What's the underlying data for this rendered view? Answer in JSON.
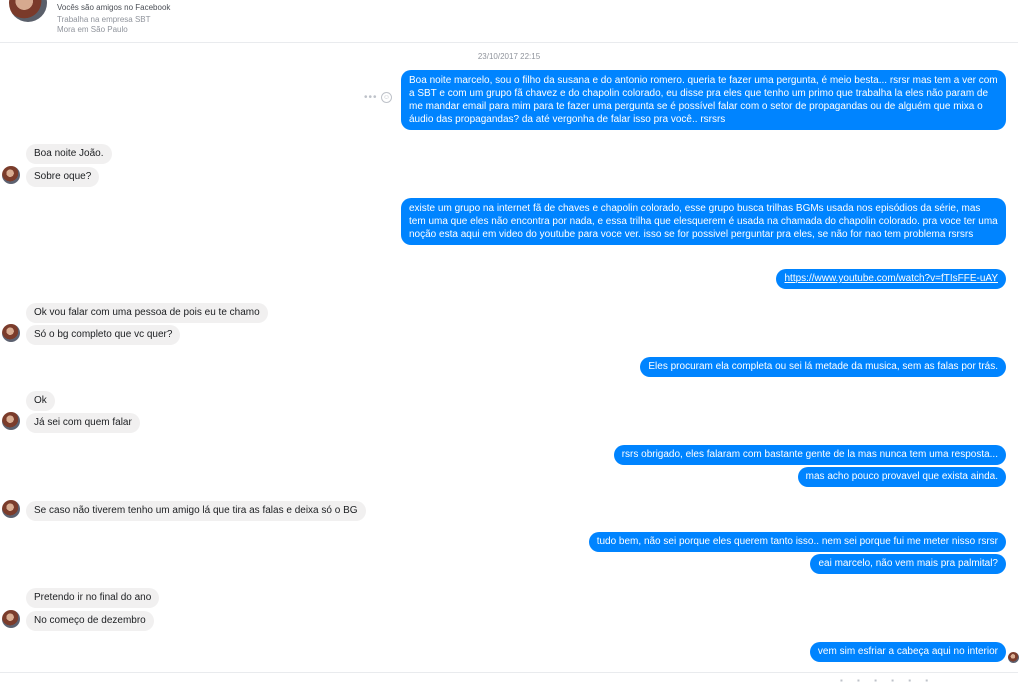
{
  "profile": {
    "friends_text": "Vocês são amigos no Facebook",
    "work_text": "Trabalha na empresa SBT",
    "city_text": "Mora em São Paulo"
  },
  "timestamp": "23/10/2017 22:15",
  "messages": [
    {
      "from": "me",
      "text": "Boa noite marcelo, sou o filho da susana e do antonio romero. queria te fazer uma pergunta, é meio besta... rsrsr mas tem a ver com a SBT e com um grupo fã chavez e do chapolin colorado, eu disse pra eles que tenho um primo que trabalha la eles não param de me mandar email para mim para te fazer uma pergunta se é possível falar com o setor de propagandas ou de alguém que mixa o áudio das propagandas? da até vergonha de falar isso pra você.. rsrsrs"
    },
    {
      "from": "them",
      "text": "Boa noite João."
    },
    {
      "from": "them",
      "text": "Sobre oque?"
    },
    {
      "from": "me",
      "text": "existe um grupo na internet fã de chaves e chapolin colorado, esse grupo busca trilhas BGMs usada nos episódios da série, mas tem uma que eles não encontra por nada, e essa  trilha que elesquerem é usada na chamada do chapolin colorado. pra voce ter uma noção esta aqui em video do youtube para voce ver. isso se for possivel perguntar pra eles, se não for nao tem problema rsrsrs"
    },
    {
      "from": "me",
      "text": "https://www.youtube.com/watch?v=fTIsFFE-uAY"
    },
    {
      "from": "them",
      "text": "Ok vou falar com uma pessoa de pois eu te chamo"
    },
    {
      "from": "them",
      "text": "Só o bg  completo que vc quer?"
    },
    {
      "from": "me",
      "text": "Eles procuram ela completa ou sei lá metade da musica, sem as falas por trás."
    },
    {
      "from": "them",
      "text": "Ok"
    },
    {
      "from": "them",
      "text": "Já sei com quem falar"
    },
    {
      "from": "me",
      "text": "rsrs obrigado, eles falaram com bastante gente de la mas nunca tem uma resposta..."
    },
    {
      "from": "me",
      "text": "mas acho pouco provavel que exista ainda."
    },
    {
      "from": "them",
      "text": "Se caso não tiverem tenho um amigo lá que tira as falas e deixa só o BG"
    },
    {
      "from": "me",
      "text": "tudo bem, não sei porque eles querem tanto isso.. nem sei porque fui me meter nisso rsrsr"
    },
    {
      "from": "me",
      "text": "eai marcelo, não vem mais pra palmital?"
    },
    {
      "from": "them",
      "text": "Pretendo ir no final do ano"
    },
    {
      "from": "them",
      "text": "No começo de dezembro"
    },
    {
      "from": "me",
      "text": "vem sim esfriar a cabeça aqui no interior"
    }
  ],
  "icons": {
    "more": "more-icon",
    "emoji": "emoji-icon"
  },
  "colors": {
    "outgoing_bubble": "#0084ff",
    "incoming_bubble": "#f1f0f0"
  }
}
